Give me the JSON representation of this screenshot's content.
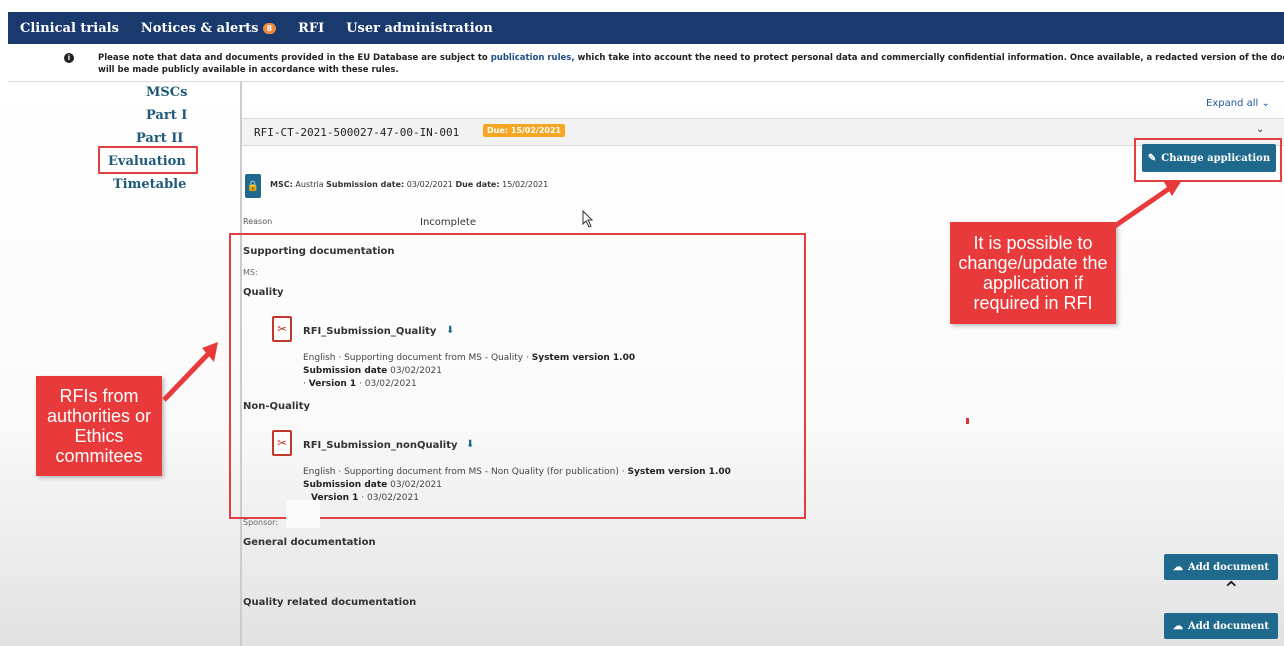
{
  "nav": {
    "items": [
      {
        "label": "Clinical trials"
      },
      {
        "label": "Notices & alerts",
        "badge": "8"
      },
      {
        "label": "RFI"
      },
      {
        "label": "User administration"
      }
    ]
  },
  "notice": {
    "text_before": "Please note that data and documents provided in the EU Database are subject to",
    "link": "publication rules,",
    "text_after": "which take into account the need to protect personal data and commercially confidential information. Once available, a redacted version of the documents",
    "line2": "will be made publicly available in accordance with these rules."
  },
  "leftnav": {
    "msc": "MSCs",
    "part1": "Part I",
    "part2": "Part II",
    "evaluation": "Evaluation",
    "timetable": "Timetable"
  },
  "expand_all": "Expand all",
  "rfi": {
    "id": "RFI-CT-2021-500027-47-00-IN-001",
    "due_badge": "Due: 15/02/2021",
    "change_button": "Change application",
    "msc_label": "MSC:",
    "msc_value": "Austria",
    "submission_label": "Submission date:",
    "submission_value": "03/02/2021",
    "due_label": "Due date:",
    "due_value": "15/02/2021",
    "reason_label": "Reason",
    "reason_value": "Incomplete"
  },
  "supporting": {
    "heading": "Supporting documentation",
    "ms_label": "MS:",
    "quality_heading": "Quality",
    "doc1": {
      "name": "RFI_Submission_Quality",
      "meta1_a": "English · Supporting document from MS - Quality ·",
      "meta1_b": "System version 1.00",
      "meta2_label": "Submission date",
      "meta2_value": "03/02/2021",
      "meta3_prefix": "·",
      "meta3_label": "Version 1",
      "meta3_value": "· 03/02/2021"
    },
    "nonquality_heading": "Non-Quality",
    "doc2": {
      "name": "RFI_Submission_nonQuality",
      "meta1_a": "English · Supporting document from MS - Non Quality (for publication) ·",
      "meta1_b": "System version 1.00",
      "meta2_label": "Submission date",
      "meta2_value": "03/02/2021",
      "meta3_label": "Version 1",
      "meta3_value": "· 03/02/2021"
    },
    "sponsor_label": "Sponsor:"
  },
  "general": {
    "heading": "General documentation",
    "add_button": "Add document"
  },
  "quality_related": {
    "heading": "Quality related documentation",
    "add_button": "Add document"
  },
  "callouts": {
    "left": "RFIs from authorities or Ethics commitees",
    "right": "It is possible to change/update the application if required in RFI"
  },
  "colors": {
    "nav_bg": "#1a3a6e",
    "button": "#1f6a8c",
    "callout": "#e83a3a",
    "due_badge": "#f5a623"
  }
}
